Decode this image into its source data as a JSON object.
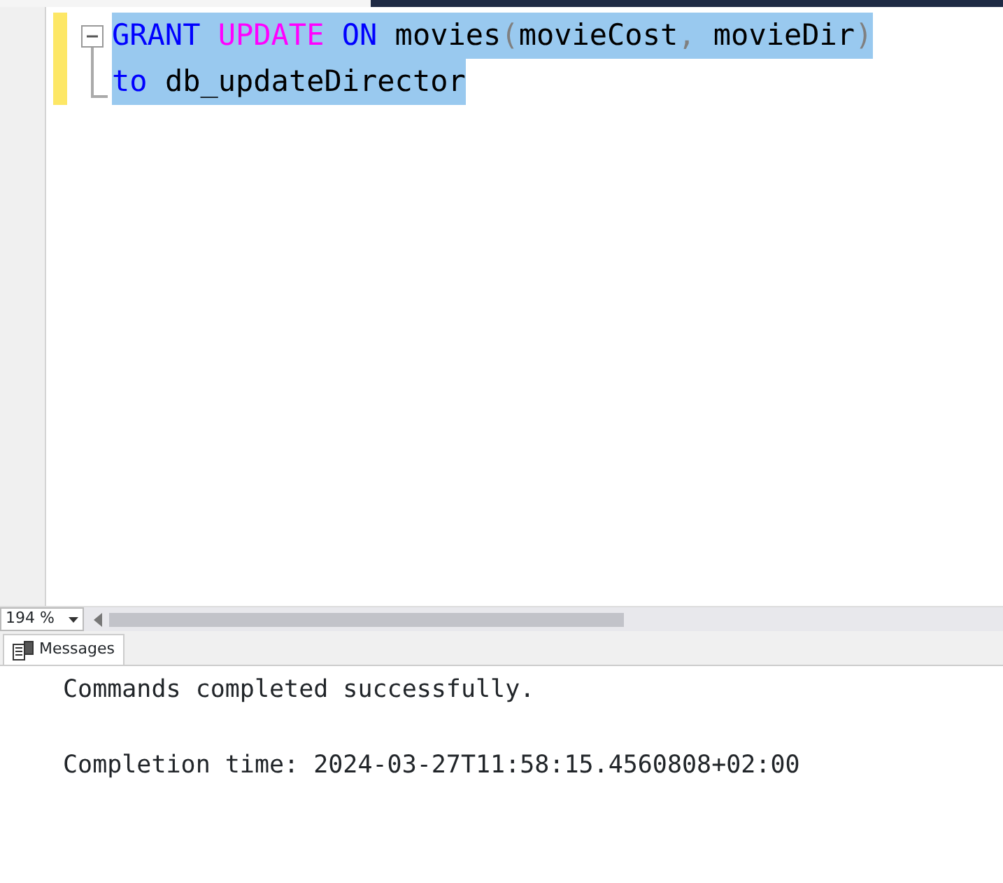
{
  "editor": {
    "lines": [
      {
        "selected": true,
        "tokens": [
          {
            "kind": "keyword",
            "text": "GRANT",
            "space_after": true
          },
          {
            "kind": "function",
            "text": "UPDATE",
            "space_after": true
          },
          {
            "kind": "keyword",
            "text": "ON",
            "space_after": true
          },
          {
            "kind": "identifier",
            "text": "movies",
            "space_after": false
          },
          {
            "kind": "punct",
            "text": "(",
            "space_after": false
          },
          {
            "kind": "identifier",
            "text": "movieCost",
            "space_after": false
          },
          {
            "kind": "punct",
            "text": ",",
            "space_after": true
          },
          {
            "kind": "identifier",
            "text": "movieDir",
            "space_after": false
          },
          {
            "kind": "punct",
            "text": ")",
            "space_after": false
          }
        ]
      },
      {
        "selected": true,
        "tokens": [
          {
            "kind": "keyword",
            "text": "to",
            "space_after": true
          },
          {
            "kind": "identifier",
            "text": "db_updateDirector",
            "space_after": false
          }
        ]
      }
    ]
  },
  "zoom": {
    "value": "194 %"
  },
  "results": {
    "tabs": [
      {
        "label": "Messages",
        "selected": true
      }
    ],
    "messages": [
      "Commands completed successfully.",
      "Completion time: 2024-03-27T11:58:15.4560808+02:00"
    ]
  }
}
